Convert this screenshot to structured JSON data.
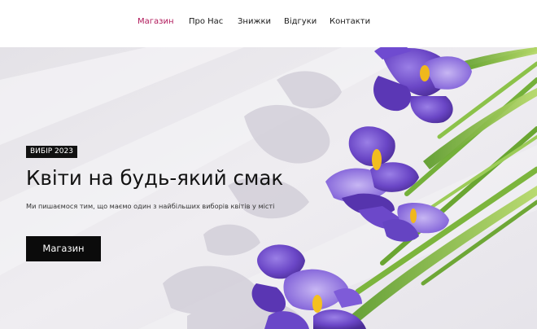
{
  "nav": {
    "items": [
      {
        "label": "Магазин",
        "active": true
      },
      {
        "label": "Про Нас",
        "active": false
      },
      {
        "label": "Знижки",
        "active": false
      },
      {
        "label": "Відгуки",
        "active": false
      },
      {
        "label": "Контакти",
        "active": false
      }
    ]
  },
  "hero": {
    "badge": "ВИБІР 2023",
    "title": "Квіти на будь-який смак",
    "subtitle": "Ми пишаємося тим, що маємо один з найбільших виборів квітів у місті",
    "cta_label": "Магазин",
    "image_subject": "purple iris flowers on light background"
  },
  "colors": {
    "accent": "#b0185a",
    "text": "#1a1a1a",
    "button_bg": "#0b0b0b",
    "hero_bg": "#e9e7ec"
  }
}
